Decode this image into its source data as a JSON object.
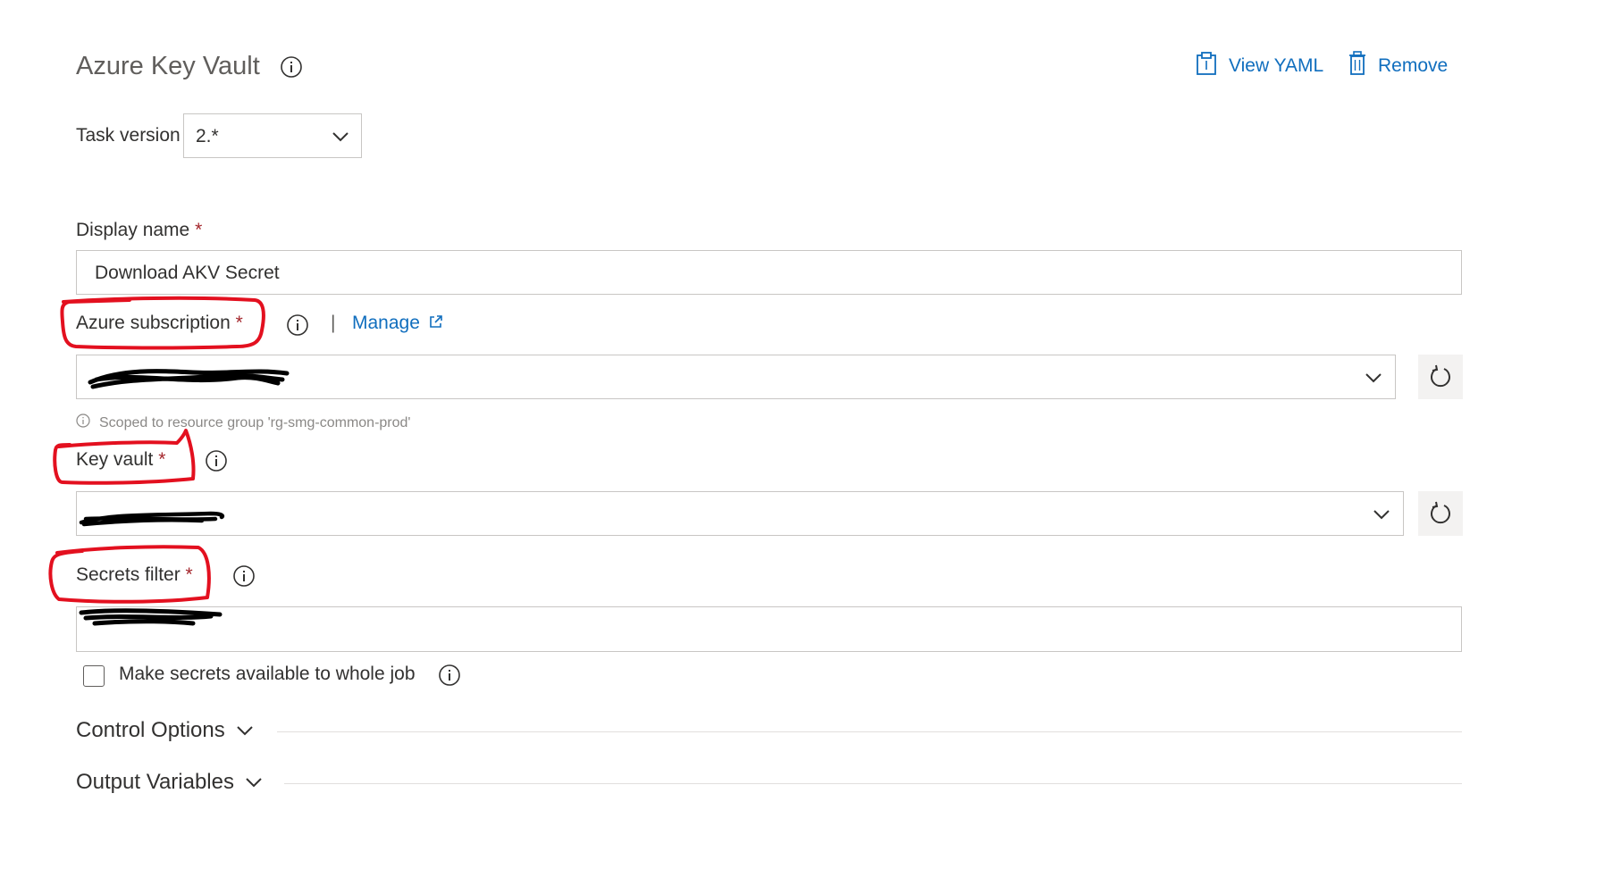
{
  "header": {
    "title": "Azure Key Vault",
    "view_yaml": "View YAML",
    "remove": "Remove"
  },
  "task_version": {
    "label": "Task version",
    "value": "2.*"
  },
  "display_name": {
    "label": "Display name",
    "required_mark": "*",
    "value": "Download AKV Secret"
  },
  "azure_subscription": {
    "label": "Azure subscription",
    "required_mark": "*",
    "separator": "|",
    "manage": "Manage",
    "hint": "Scoped to resource group 'rg-smg-common-prod'"
  },
  "key_vault": {
    "label": "Key vault",
    "required_mark": "*"
  },
  "secrets_filter": {
    "label": "Secrets filter",
    "required_mark": "*"
  },
  "whole_job": {
    "label": "Make secrets available to whole job",
    "checked": false
  },
  "sections": {
    "control_options": "Control Options",
    "output_variables": "Output Variables"
  },
  "colors": {
    "link": "#106ebe",
    "annotation": "#e3101f",
    "required": "#a4262c"
  }
}
